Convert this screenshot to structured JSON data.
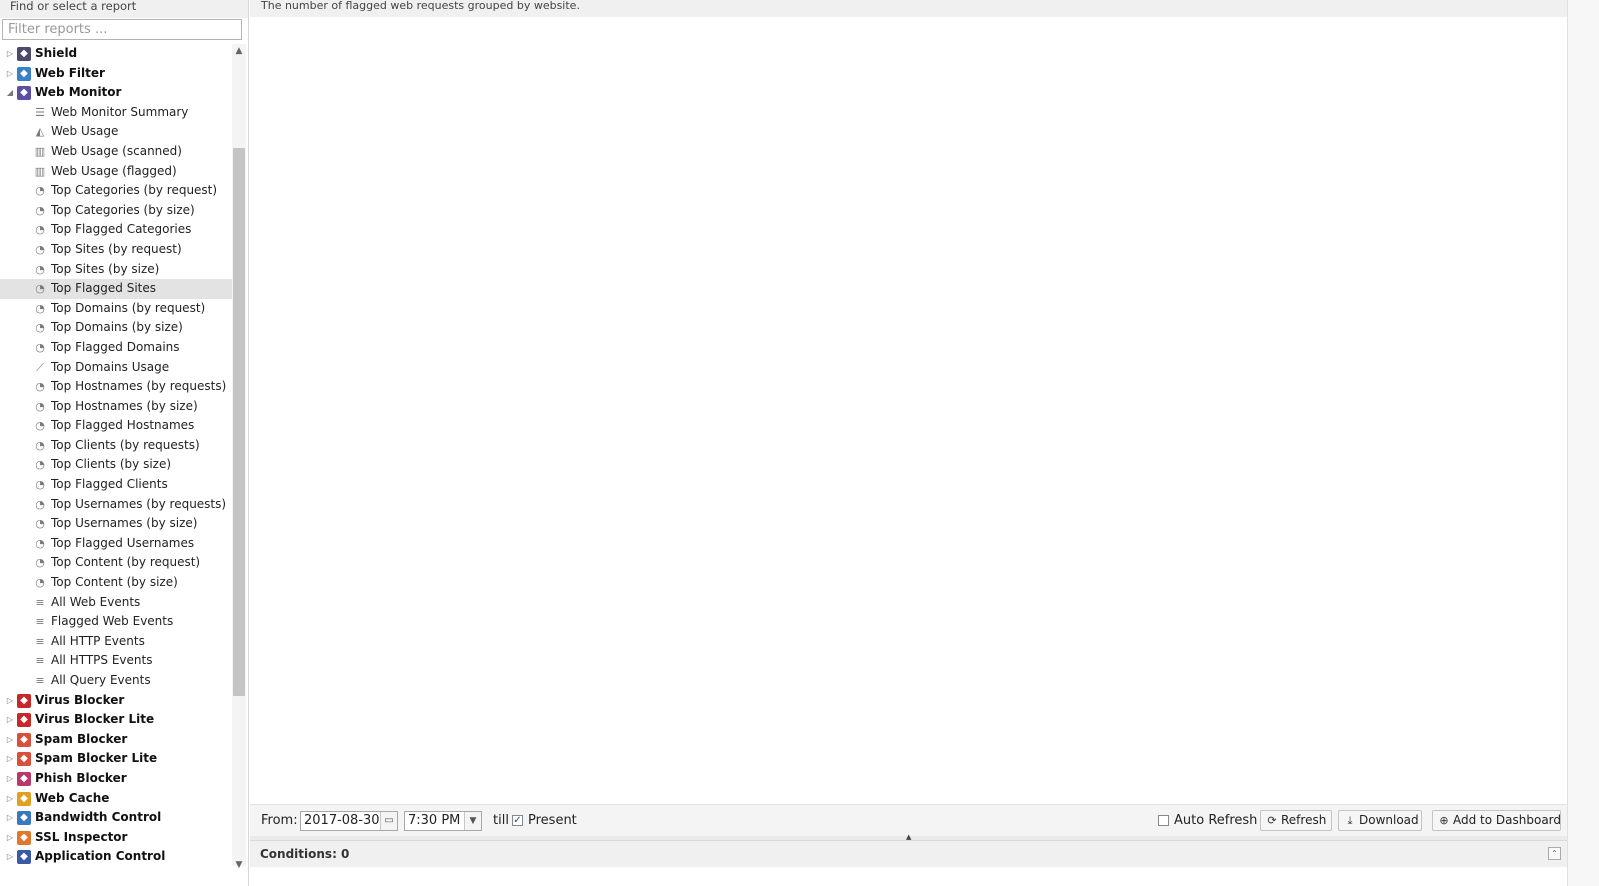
{
  "sidebar": {
    "header": "Find or select a report",
    "filter_placeholder": "Filter reports ...",
    "apps_top": [
      {
        "label": "Shield",
        "icon": "shield-icon",
        "color": "#4a4a6a",
        "expanded": false
      },
      {
        "label": "Web Filter",
        "icon": "web-filter-icon",
        "color": "#3a7fc8",
        "expanded": false
      },
      {
        "label": "Web Monitor",
        "icon": "web-monitor-icon",
        "color": "#5a4fa0",
        "expanded": true
      }
    ],
    "reports": [
      {
        "label": "Web Monitor Summary",
        "icon": "summary-lines-icon"
      },
      {
        "label": "Web Usage",
        "icon": "area-chart-icon"
      },
      {
        "label": "Web Usage (scanned)",
        "icon": "bar-chart-icon"
      },
      {
        "label": "Web Usage (flagged)",
        "icon": "bar-chart-icon"
      },
      {
        "label": "Top Categories (by request)",
        "icon": "pie-chart-icon"
      },
      {
        "label": "Top Categories (by size)",
        "icon": "pie-chart-icon"
      },
      {
        "label": "Top Flagged Categories",
        "icon": "pie-chart-icon"
      },
      {
        "label": "Top Sites (by request)",
        "icon": "pie-chart-icon"
      },
      {
        "label": "Top Sites (by size)",
        "icon": "pie-chart-icon"
      },
      {
        "label": "Top Flagged Sites",
        "icon": "pie-chart-icon",
        "selected": true
      },
      {
        "label": "Top Domains (by request)",
        "icon": "pie-chart-icon"
      },
      {
        "label": "Top Domains (by size)",
        "icon": "pie-chart-icon"
      },
      {
        "label": "Top Flagged Domains",
        "icon": "pie-chart-icon"
      },
      {
        "label": "Top Domains Usage",
        "icon": "line-chart-icon"
      },
      {
        "label": "Top Hostnames (by requests)",
        "icon": "pie-chart-icon"
      },
      {
        "label": "Top Hostnames (by size)",
        "icon": "pie-chart-icon"
      },
      {
        "label": "Top Flagged Hostnames",
        "icon": "pie-chart-icon"
      },
      {
        "label": "Top Clients (by requests)",
        "icon": "pie-chart-icon"
      },
      {
        "label": "Top Clients (by size)",
        "icon": "pie-chart-icon"
      },
      {
        "label": "Top Flagged Clients",
        "icon": "pie-chart-icon"
      },
      {
        "label": "Top Usernames (by requests)",
        "icon": "pie-chart-icon"
      },
      {
        "label": "Top Usernames (by size)",
        "icon": "pie-chart-icon"
      },
      {
        "label": "Top Flagged Usernames",
        "icon": "pie-chart-icon"
      },
      {
        "label": "Top Content (by request)",
        "icon": "pie-chart-icon"
      },
      {
        "label": "Top Content (by size)",
        "icon": "pie-chart-icon"
      },
      {
        "label": "All Web Events",
        "icon": "list-icon"
      },
      {
        "label": "Flagged Web Events",
        "icon": "list-icon"
      },
      {
        "label": "All HTTP Events",
        "icon": "list-icon"
      },
      {
        "label": "All HTTPS Events",
        "icon": "list-icon"
      },
      {
        "label": "All Query Events",
        "icon": "list-icon"
      }
    ],
    "apps_bottom": [
      {
        "label": "Virus Blocker",
        "icon": "virus-blocker-icon",
        "color": "#c8282a"
      },
      {
        "label": "Virus Blocker Lite",
        "icon": "virus-blocker-lite-icon",
        "color": "#c8282a"
      },
      {
        "label": "Spam Blocker",
        "icon": "spam-blocker-icon",
        "color": "#d6503a"
      },
      {
        "label": "Spam Blocker Lite",
        "icon": "spam-blocker-lite-icon",
        "color": "#d6503a"
      },
      {
        "label": "Phish Blocker",
        "icon": "phish-blocker-icon",
        "color": "#b83a6a"
      },
      {
        "label": "Web Cache",
        "icon": "web-cache-icon",
        "color": "#e0a020"
      },
      {
        "label": "Bandwidth Control",
        "icon": "bandwidth-control-icon",
        "color": "#3a78c0"
      },
      {
        "label": "SSL Inspector",
        "icon": "ssl-inspector-icon",
        "color": "#e07830"
      },
      {
        "label": "Application Control",
        "icon": "application-control-icon",
        "color": "#3a5aa8"
      }
    ]
  },
  "main": {
    "description": "The number of flagged web requests grouped by website.",
    "toolbar": {
      "from_label": "From:",
      "date_value": "2017-08-30",
      "time_value": "7:30 PM",
      "till_label": "till",
      "present_label": "Present",
      "present_checked": "✓",
      "auto_refresh_label": "Auto Refresh",
      "refresh_label": "Refresh",
      "download_label": "Download",
      "add_dashboard_label": "Add to Dashboard"
    },
    "conditions_label": "Conditions: 0"
  }
}
